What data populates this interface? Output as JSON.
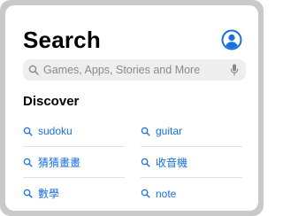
{
  "header": {
    "title": "Search"
  },
  "search": {
    "placeholder": "Games, Apps, Stories and More",
    "value": ""
  },
  "discover": {
    "title": "Discover",
    "items": [
      {
        "label": "sudoku"
      },
      {
        "label": "guitar"
      },
      {
        "label": "猜猜畫畫"
      },
      {
        "label": "收音機"
      },
      {
        "label": "數學"
      },
      {
        "label": "note"
      }
    ]
  },
  "colors": {
    "accent": "#1a6fe0",
    "search_field_bg": "#eeeeef",
    "frame": "#c9c9c9",
    "placeholder": "#8a8a8e"
  },
  "icons": {
    "profile": "person-circle-icon",
    "search": "search-icon",
    "mic": "microphone-icon"
  }
}
